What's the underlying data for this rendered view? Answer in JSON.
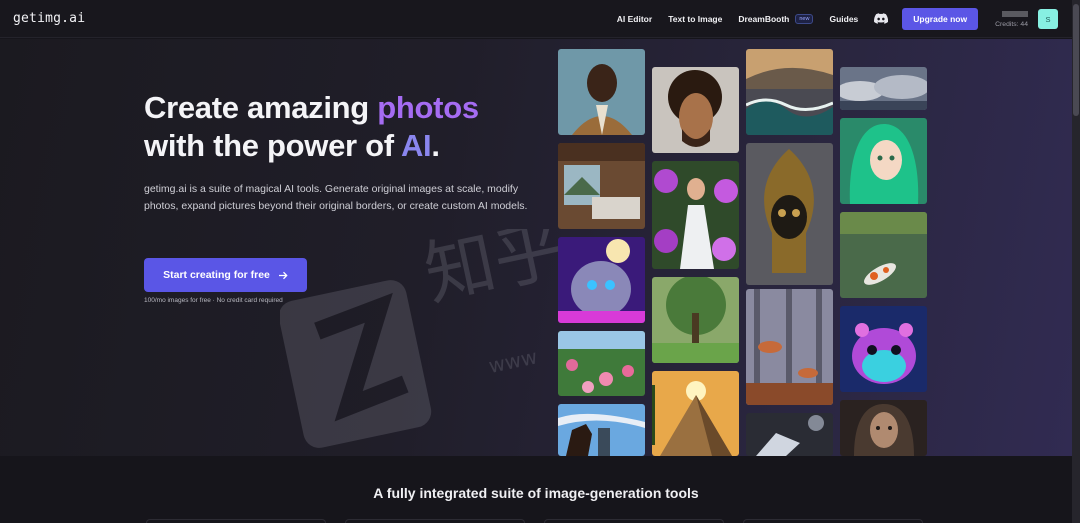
{
  "brand": {
    "logo_text": "getimg.ai"
  },
  "nav": {
    "links": [
      "AI Editor",
      "Text to Image",
      "DreamBooth",
      "Guides"
    ],
    "dreambooth_badge": "new",
    "discord_icon": "discord-icon",
    "upgrade_label": "Upgrade now",
    "credits_text": "Credits: 44",
    "avatar_initial": "S"
  },
  "hero": {
    "title_part1": "Create amazing ",
    "title_accent1": "photos",
    "title_part2": "with the power of ",
    "title_accent2": "AI",
    "title_end": ".",
    "description": "getimg.ai is a suite of magical AI tools. Generate original images at scale, modify photos, expand pictures beyond their original borders, or create custom AI models.",
    "cta_label": "Start creating for free",
    "cta_icon": "arrow-right-icon",
    "note": "100/mo images for free · No credit card required"
  },
  "colors": {
    "accent": "#a56cf2",
    "accent_ai": "#8a86ee",
    "button": "#5a56e6",
    "avatar_bg": "#87f0e2"
  },
  "gallery": {
    "tiles": [
      "portrait-man-suit",
      "curly-hair-man",
      "stormy-sea",
      "clouds",
      "green-hair-girl",
      "cabin-bedroom",
      "woman-flowers",
      "golden-skull-sculpture",
      "cosmic-cat",
      "koi-pond",
      "rose-garden",
      "tree-meadow",
      "mushroom-forest",
      "galaxy-hamster",
      "horse-rider",
      "pyramid",
      "glass-object",
      "cyborg-woman"
    ]
  },
  "section": {
    "title": "A fully integrated suite of image-generation tools"
  }
}
